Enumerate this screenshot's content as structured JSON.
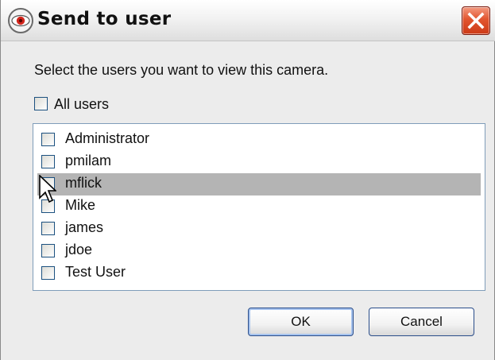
{
  "window": {
    "title": "Send to user"
  },
  "prompt": "Select the users you want to view this camera.",
  "all_users": {
    "label": "All users",
    "checked": false
  },
  "users": [
    {
      "label": "Administrator",
      "checked": false,
      "selected": false
    },
    {
      "label": "pmilam",
      "checked": false,
      "selected": false
    },
    {
      "label": "mflick",
      "checked": false,
      "selected": true
    },
    {
      "label": "Mike",
      "checked": false,
      "selected": false
    },
    {
      "label": "james",
      "checked": false,
      "selected": false
    },
    {
      "label": "jdoe",
      "checked": false,
      "selected": false
    },
    {
      "label": "Test User",
      "checked": false,
      "selected": false
    }
  ],
  "buttons": {
    "ok": "OK",
    "cancel": "Cancel"
  },
  "colors": {
    "selection": "#b4b4b4",
    "close_button": "#e2552f",
    "checkbox_border": "#1c5180"
  }
}
